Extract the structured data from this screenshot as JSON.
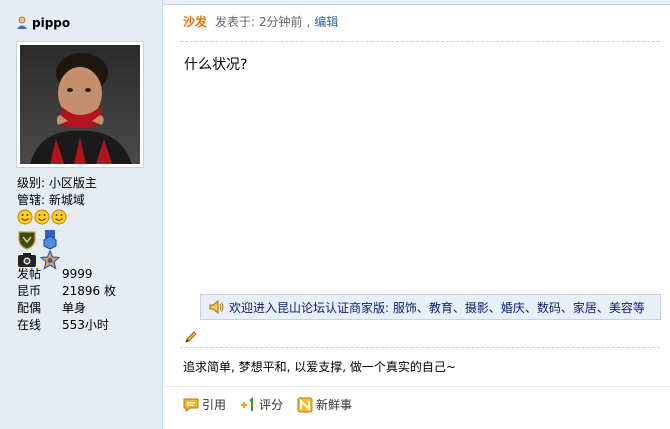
{
  "user": {
    "name": "pippo",
    "level_label": "级别:",
    "level_value": "小区版主",
    "region_label": "管辖:",
    "region_value": "新城域",
    "stats": [
      {
        "label": "发帖",
        "value": "9999"
      },
      {
        "label": "昆币",
        "value": "21896 枚"
      },
      {
        "label": "配偶",
        "value": "单身"
      },
      {
        "label": "在线",
        "value": "553小时"
      }
    ]
  },
  "post": {
    "author": "沙发",
    "posted_text": "发表于: 2分钟前",
    "separator": ",",
    "edit_label": "编辑",
    "body": "什么状况?",
    "notice": "欢迎进入昆山论坛认证商家版: 服饰、教育、摄影、婚庆、数码、家居、美容等",
    "signature": "追求简单, 梦想平和, 以爱支撑, 做一个真实的自己~"
  },
  "actions": {
    "quote_label": "引用",
    "rate_label": "评分",
    "news_label": "新鲜事"
  },
  "colors": {
    "sidebar_bg": "#e5edf2",
    "author": "#e2760d",
    "link": "#336699",
    "notice_bg": "#e8eff7"
  }
}
